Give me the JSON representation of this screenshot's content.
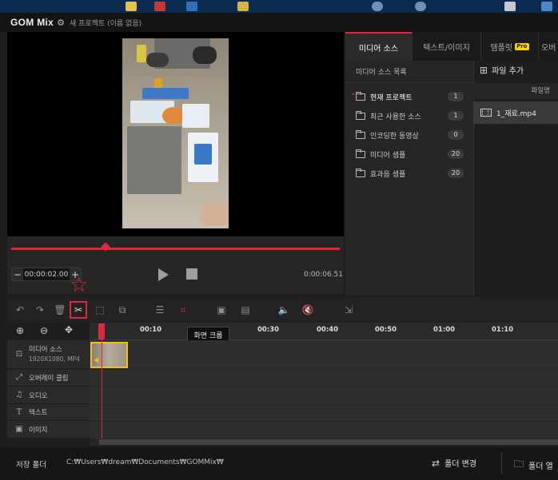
{
  "app": {
    "logo": "GOM Mix",
    "project_title": "새 프로젝트 (이름 없음)"
  },
  "player": {
    "timecode": "00:00:02.00",
    "total_time": "0:00:06.51",
    "minus": "−",
    "plus": "+"
  },
  "tabs": [
    {
      "label": "미디어 소스",
      "active": true
    },
    {
      "label": "텍스트/이미지",
      "active": false
    },
    {
      "label": "템플릿",
      "badge": "Pro",
      "active": false
    },
    {
      "label": "오버",
      "active": false
    }
  ],
  "source_list": {
    "header": "미디어 소스 목록",
    "items": [
      {
        "label": "현재 프로젝트",
        "count": "1",
        "active": true
      },
      {
        "label": "최근 사용한 소스",
        "count": "1"
      },
      {
        "label": "인코딩한 동영상",
        "count": "0"
      },
      {
        "label": "미디어 샘플",
        "count": "20"
      },
      {
        "label": "효과음 샘플",
        "count": "20"
      }
    ]
  },
  "files": {
    "add_label": "파일 추가",
    "column_header": "파일명",
    "items": [
      "1_재료.mp4"
    ]
  },
  "timeline": {
    "ticks": [
      "00:10",
      "00:30",
      "00:40",
      "00:50",
      "01:00",
      "01:10"
    ],
    "tooltip": "화면 크롭",
    "tracks": [
      {
        "label": "미디어 소스",
        "sub": "1920X1080, MP4",
        "icon": "film-icon"
      },
      {
        "label": "오버레이 클립",
        "icon": "overlay-icon"
      },
      {
        "label": "오디오",
        "icon": "music-icon"
      },
      {
        "label": "텍스트",
        "icon": "text-icon"
      },
      {
        "label": "이미지",
        "icon": "image-icon"
      }
    ]
  },
  "footer": {
    "save_label": "저장 폴더",
    "save_path": "C:₩Users₩dream₩Documents₩GOMMix₩",
    "change_folder": "폴더 변경",
    "open_folder": "폴더 열"
  },
  "colors": {
    "accent": "#e0283c",
    "clip_border": "#f0c020",
    "pro_badge": "#ffd400"
  }
}
